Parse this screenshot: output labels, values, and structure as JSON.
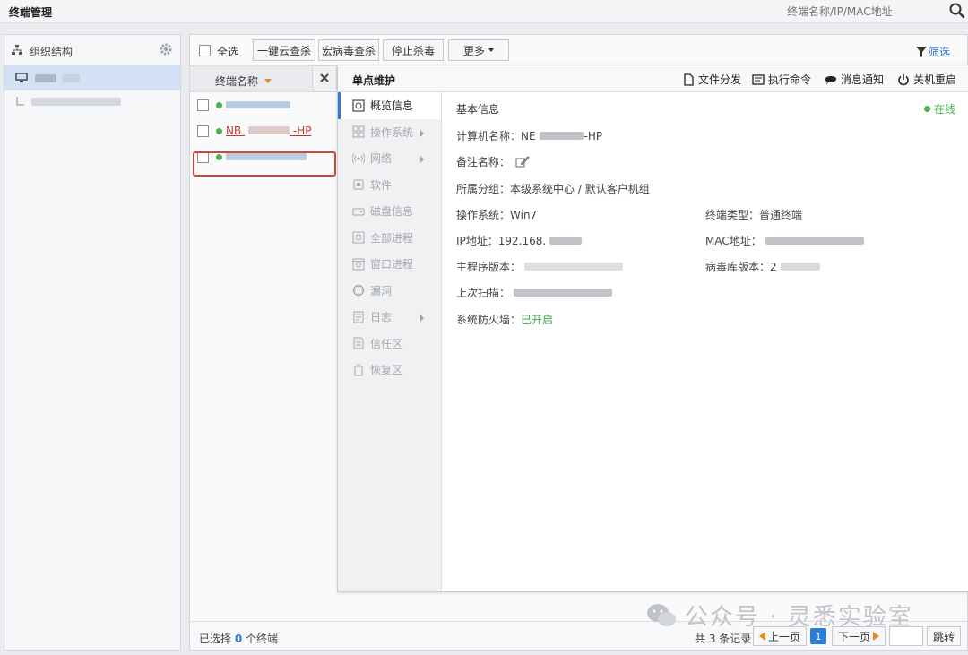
{
  "window": {
    "title": "终端管理",
    "search_placeholder": "终端名称/IP/MAC地址"
  },
  "org_panel": {
    "title": "组织结构"
  },
  "toolbar": {
    "select_all": "全选",
    "cloud_scan": "一键云查杀",
    "macro_scan": "宏病毒查杀",
    "stop_kill": "停止杀毒",
    "more": "更多",
    "filter": "筛选"
  },
  "terminal_list": {
    "column_header": "终端名称",
    "items": [
      {
        "name": "",
        "status": "online"
      },
      {
        "name": "NB",
        "name_suffix": "-HP",
        "status": "online",
        "highlighted": true
      },
      {
        "name": "",
        "status": "online"
      }
    ]
  },
  "detail": {
    "title": "单点维护",
    "actions": [
      "文件分发",
      "执行命令",
      "消息通知",
      "关机重启"
    ],
    "nav": [
      {
        "label": "概览信息",
        "icon": "overview-icon",
        "active": true
      },
      {
        "label": "操作系统",
        "icon": "windows-icon",
        "submenu": true
      },
      {
        "label": "网络",
        "icon": "network-icon",
        "submenu": true
      },
      {
        "label": "软件",
        "icon": "software-icon"
      },
      {
        "label": "磁盘信息",
        "icon": "disk-icon"
      },
      {
        "label": "全部进程",
        "icon": "process-icon"
      },
      {
        "label": "窗口进程",
        "icon": "window-process-icon"
      },
      {
        "label": "漏洞",
        "icon": "vulnerability-icon"
      },
      {
        "label": "日志",
        "icon": "log-icon",
        "submenu": true
      },
      {
        "label": "信任区",
        "icon": "trust-icon"
      },
      {
        "label": "恢复区",
        "icon": "restore-icon"
      }
    ],
    "section_title": "基本信息",
    "status": "在线",
    "fields": {
      "computer_name_label": "计算机名称：",
      "computer_name_prefix": "NE",
      "computer_name_suffix": "-HP",
      "remark_label": "备注名称：",
      "group_label": "所属分组：",
      "group_value": "本级系统中心 / 默认客户机组",
      "os_label": "操作系统：",
      "os_value": "Win7",
      "terminal_type_label": "终端类型：",
      "terminal_type_value": "普通终端",
      "ip_label": "IP地址：",
      "ip_value": "192.168.",
      "mac_label": "MAC地址：",
      "main_version_label": "主程序版本：",
      "virus_db_label": "病毒库版本：",
      "virus_db_value": "2",
      "last_scan_label": "上次扫描：",
      "firewall_label": "系统防火墙：",
      "firewall_value": "已开启"
    }
  },
  "footer": {
    "selected_prefix": "已选择",
    "selected_count": "0",
    "selected_suffix": "个终端",
    "total": "共 3 条记录",
    "prev": "上一页",
    "current_page": "1",
    "next": "下一页",
    "jump": "跳转"
  },
  "watermark": "公众号 · 灵悉实验室",
  "colors": {
    "accent": "#2d7dd2",
    "online": "#4caf50",
    "highlight": "#d1453b"
  }
}
